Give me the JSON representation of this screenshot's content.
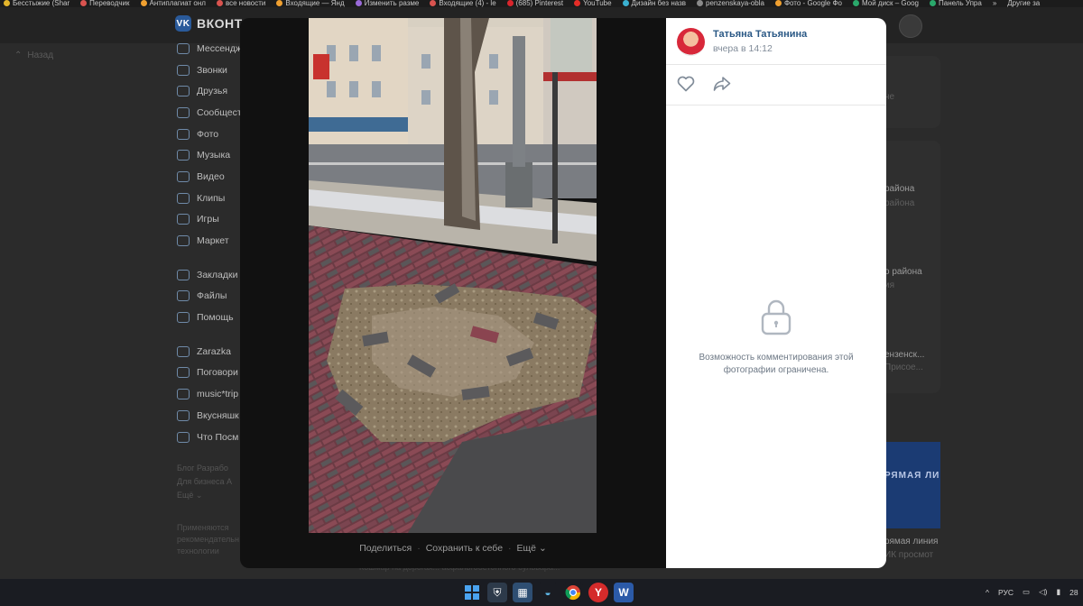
{
  "bookmarks": [
    {
      "label": "Бесстыжие (Shar",
      "color": "#e3b52b"
    },
    {
      "label": "Переводчик",
      "color": "#d9534f"
    },
    {
      "label": "Антиплагиат онл",
      "color": "#f0a030"
    },
    {
      "label": "все новости",
      "color": "#d9534f"
    },
    {
      "label": "Входящие — Янд",
      "color": "#f0a030"
    },
    {
      "label": "Изменить разме",
      "color": "#9a6ad9"
    },
    {
      "label": "Входящие (4) - le",
      "color": "#d9534f"
    },
    {
      "label": "(685) Pinterest",
      "color": "#d9252c"
    },
    {
      "label": "YouTube",
      "color": "#e52d27"
    },
    {
      "label": "Дизайн без назв",
      "color": "#3ab0d0"
    },
    {
      "label": "penzenskaya-obla",
      "color": "#8a8a8a"
    },
    {
      "label": "Фото - Google Фо",
      "color": "#f0a030"
    },
    {
      "label": "Мой диск – Goog",
      "color": "#2aa86b"
    },
    {
      "label": "Панель Упра",
      "color": "#2aa86b"
    },
    {
      "label": "»",
      "color": ""
    },
    {
      "label": "Другие за",
      "color": ""
    }
  ],
  "vk": {
    "logo_mark": "VK",
    "logo_text": "ВКОНТ",
    "back_label": "Назад",
    "menu": [
      "Мессендж",
      "Звонки",
      "Друзья",
      "Сообщест",
      "Фото",
      "Музыка",
      "Видео",
      "Клипы",
      "Игры",
      "Маркет"
    ],
    "menu2": [
      "Закладки",
      "Файлы",
      "Помощь"
    ],
    "menu3": [
      "Zarazka",
      "Поговори",
      "music*trip",
      "Вкусняшк",
      "Что Посм"
    ],
    "footer_links_1": "Блог   Разрабо",
    "footer_links_2": "Для бизнеса   А",
    "footer_links_3": "Ещё ⌄",
    "footer_note_1": "Применяются",
    "footer_note_2": "рекомендательн",
    "footer_note_3": "технологии",
    "right": {
      "r1a": "не",
      "r2a": "района",
      "r2b": "района",
      "r3a": "о района",
      "r3b": "ия",
      "r4a": "ензенск...",
      "r4b": "Присое...",
      "promo_text": "РЯМАЯ ЛИ",
      "promo_title": "рямая линия",
      "promo_sub": "ИК просмот"
    },
    "under_caption": "Кошмар на дорогах... асфальтобетонного бульвара..."
  },
  "viewer": {
    "share_label": "Поделиться",
    "save_label": "Сохранить к себе",
    "more_label": "Ещё",
    "separator": "·"
  },
  "panel": {
    "author": "Татьяна Татьянина",
    "time": "вчера в 14:12",
    "restriction_line1": "Возможность комментирования этой",
    "restriction_line2": "фотографии ограничена."
  },
  "taskbar": {
    "tray_lang": "РУС",
    "tray_time": "28"
  }
}
